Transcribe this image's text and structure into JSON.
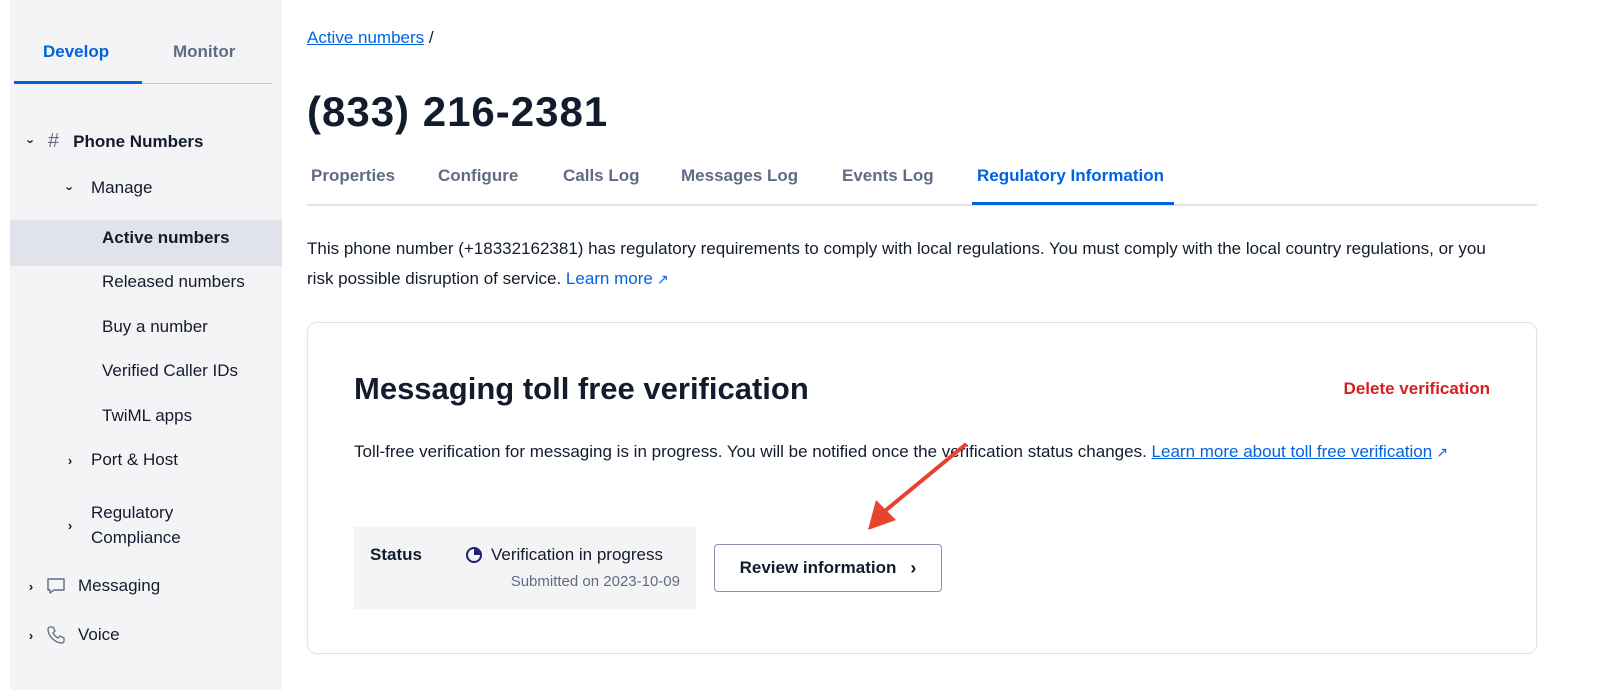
{
  "sidebar": {
    "tabs": {
      "develop": "Develop",
      "monitor": "Monitor"
    },
    "phone_numbers": "Phone Numbers",
    "manage": "Manage",
    "items": [
      "Active numbers",
      "Released numbers",
      "Buy a number",
      "Verified Caller IDs",
      "TwiML apps"
    ],
    "port_host": "Port & Host",
    "regulatory": [
      "Regulatory",
      "Compliance"
    ],
    "messaging": "Messaging",
    "voice": "Voice"
  },
  "breadcrumb": {
    "link": "Active numbers",
    "separator": "/"
  },
  "page_title": "(833) 216-2381",
  "tabs": [
    "Properties",
    "Configure",
    "Calls Log",
    "Messages Log",
    "Events Log",
    "Regulatory Information"
  ],
  "intro": {
    "text": "This phone number (+18332162381) has regulatory requirements to comply with local regulations. You must comply with the local country regulations, or you risk possible disruption of service.",
    "link": "Learn more"
  },
  "card": {
    "title": "Messaging toll free verification",
    "delete_label": "Delete verification",
    "text": "Toll-free verification for messaging is in progress. You will be notified once the verification status changes.",
    "link": "Learn more about toll free verification",
    "status_label": "Status",
    "status_value": "Verification in progress",
    "submitted": "Submitted on 2023-10-09",
    "review_button": "Review information"
  },
  "colors": {
    "accent": "#0263e0",
    "danger": "#d61f1f",
    "annotation_arrow": "#e8432e"
  },
  "icons": [
    "chevron-down-icon",
    "chevron-right-icon",
    "hash-icon",
    "chat-icon",
    "phone-icon",
    "external-link-icon",
    "status-progress-icon"
  ]
}
